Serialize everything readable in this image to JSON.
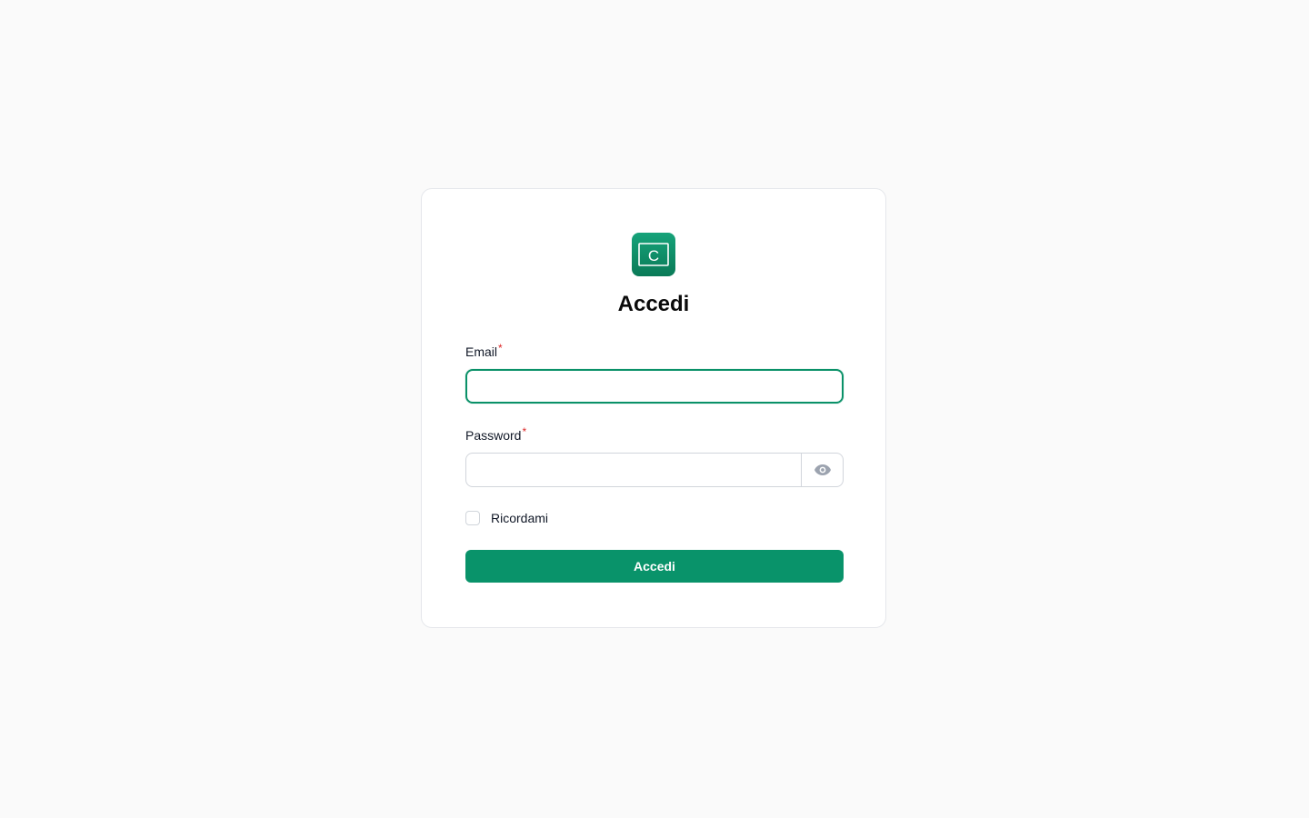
{
  "login": {
    "title": "Accedi",
    "logo_letter": "C",
    "email": {
      "label": "Email",
      "required_mark": "*",
      "value": "",
      "placeholder": ""
    },
    "password": {
      "label": "Password",
      "required_mark": "*",
      "value": "",
      "placeholder": "",
      "toggle_icon": "eye-icon"
    },
    "remember_label": "Ricordami",
    "remember_checked": false,
    "submit_label": "Accedi"
  },
  "colors": {
    "accent": "#09936a",
    "required": "#dc2626",
    "background": "#fafafa"
  }
}
